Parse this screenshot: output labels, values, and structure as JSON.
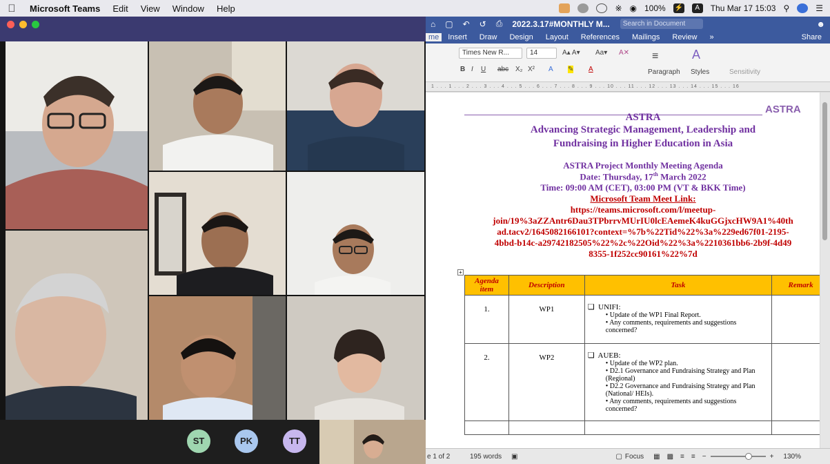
{
  "menubar": {
    "app_name": "Microsoft Teams",
    "items": [
      "Edit",
      "View",
      "Window",
      "Help"
    ],
    "battery": "100%",
    "battery_badge": "⚡",
    "input_badge": "A",
    "clock": "Thu Mar 17  15:03"
  },
  "teams": {
    "participants": [
      "ST",
      "PK",
      "TT"
    ],
    "avatar_colors": [
      "#9fd6b0",
      "#a9c7ee",
      "#c7b7ee"
    ]
  },
  "word": {
    "doc_title": "2022.3.17#MONTHLY M...",
    "search_placeholder": "Search in Document",
    "tabs": [
      "me",
      "Insert",
      "Draw",
      "Design",
      "Layout",
      "References",
      "Mailings",
      "Review",
      "»"
    ],
    "share": "Share",
    "font_name": "Times New R...",
    "font_size": "14",
    "ribbon_labels": {
      "paragraph": "Paragraph",
      "styles": "Styles",
      "sensitivity": "Sensitivity"
    },
    "ruler": "1 . . . 1 . . . 2 . . . 3 . . . 4 . . . 5 . . . 6 . . . 7 . . . 8 . . . 9 . . . 10 . . . 11 . . . 12 . . . 13 . . . 14 . . . 15 . . . 16",
    "status": {
      "page": "e 1 of 2",
      "words": "195 words",
      "focus": "Focus",
      "zoom": "130%"
    }
  },
  "document": {
    "logo": "ASTRA",
    "title": "ASTRA",
    "subtitle_1": "Advancing Strategic Management, Leadership and",
    "subtitle_2": "Fundraising in Higher Education in Asia",
    "agenda_title": "ASTRA Project Monthly Meeting Agenda",
    "date_prefix": "Date: Thursday, 17",
    "date_sup": "th",
    "date_suffix": " March 2022",
    "time": "Time: 09:00 AM (CET), 03:00 PM (VT & BKK Time)",
    "link_label": "Microsoft Team Meet Link:",
    "link_lines": [
      "https://teams.microsoft.com/l/meetup-",
      "join/19%3aZZAntr6Dau3TPbrrvMUrIU0lcEAemeK4kuGGjxcHW9A1%40th",
      "ad.tacv2/1645082166101?context=%7b%22Tid%22%3a%229ed67f01-2195-",
      "4bbd-b14c-a29742182505%22%2c%22Oid%22%3a%2210361bb6-2b9f-4d49",
      "8355-1f252cc90161%22%7d"
    ],
    "table": {
      "headers": [
        "Agenda item",
        "Description",
        "Task",
        "Remark"
      ],
      "rows": [
        {
          "num": "1.",
          "desc": "WP1",
          "org": "UNIFI:",
          "bullets": [
            "Update of the WP1 Final Report.",
            "Any comments, requirements and suggestions concerned?"
          ]
        },
        {
          "num": "2.",
          "desc": "WP2",
          "org": "AUEB:",
          "bullets": [
            "Update of the WP2 plan.",
            "D2.1 Governance and Fundraising Strategy and Plan (Regional)",
            "D2.2 Governance and Fundraising Strategy and Plan (National/ HEIs).",
            "Any comments, requirements and suggestions concerned?"
          ]
        }
      ]
    }
  }
}
